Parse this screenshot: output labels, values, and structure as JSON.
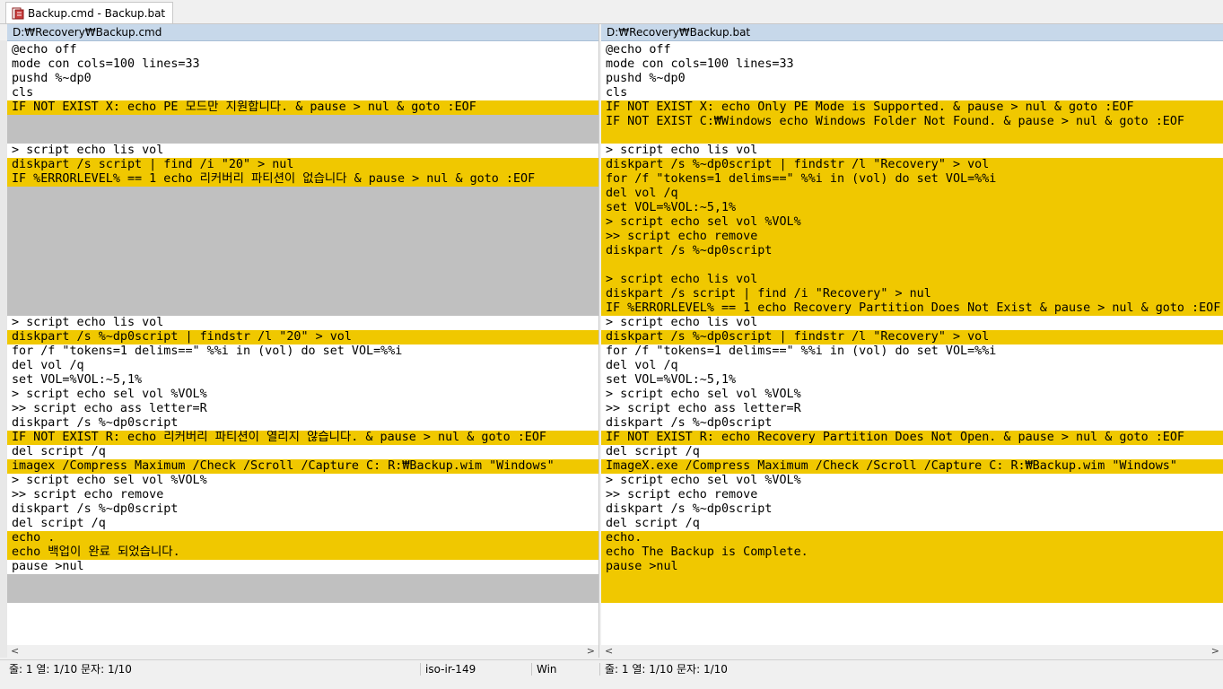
{
  "tab": {
    "title": "Backup.cmd - Backup.bat"
  },
  "left_pane": {
    "path": "D:₩Recovery₩Backup.cmd",
    "lines": [
      {
        "t": "@echo off",
        "c": ""
      },
      {
        "t": "mode con cols=100 lines=33",
        "c": ""
      },
      {
        "t": "pushd %~dp0",
        "c": ""
      },
      {
        "t": "cls",
        "c": ""
      },
      {
        "t": "IF NOT EXIST X: echo PE 모드만 지원합니다. & pause > nul & goto :EOF",
        "c": "changed"
      },
      {
        "t": "",
        "c": "gap"
      },
      {
        "t": "",
        "c": "gap"
      },
      {
        "t": "> script echo lis vol",
        "c": ""
      },
      {
        "t": "diskpart /s script | find /i \"20\" > nul",
        "c": "changed"
      },
      {
        "t": "IF %ERRORLEVEL% == 1 echo 리커버리 파티션이 없습니다 & pause > nul & goto :EOF",
        "c": "changed"
      },
      {
        "t": "",
        "c": "gap"
      },
      {
        "t": "",
        "c": "gap"
      },
      {
        "t": "",
        "c": "gap"
      },
      {
        "t": "",
        "c": "gap"
      },
      {
        "t": "",
        "c": "gap"
      },
      {
        "t": "",
        "c": "gap"
      },
      {
        "t": "",
        "c": "gap"
      },
      {
        "t": "",
        "c": "gap"
      },
      {
        "t": "",
        "c": "gap"
      },
      {
        "t": "> script echo lis vol",
        "c": ""
      },
      {
        "t": "diskpart /s %~dp0script | findstr /l \"20\" > vol",
        "c": "changed"
      },
      {
        "t": "for /f \"tokens=1 delims==\" %%i in (vol) do set VOL=%%i",
        "c": ""
      },
      {
        "t": "del vol /q",
        "c": ""
      },
      {
        "t": "set VOL=%VOL:~5,1%",
        "c": ""
      },
      {
        "t": "> script echo sel vol %VOL%",
        "c": ""
      },
      {
        "t": ">> script echo ass letter=R",
        "c": ""
      },
      {
        "t": "diskpart /s %~dp0script",
        "c": ""
      },
      {
        "t": "IF NOT EXIST R: echo 리커버리 파티션이 열리지 않습니다. & pause > nul & goto :EOF",
        "c": "changed"
      },
      {
        "t": "del script /q",
        "c": ""
      },
      {
        "t": "imagex /Compress Maximum /Check /Scroll /Capture C: R:₩Backup.wim \"Windows\"",
        "c": "changed"
      },
      {
        "t": "> script echo sel vol %VOL%",
        "c": ""
      },
      {
        "t": ">> script echo remove",
        "c": ""
      },
      {
        "t": "diskpart /s %~dp0script",
        "c": ""
      },
      {
        "t": "del script /q",
        "c": ""
      },
      {
        "t": "echo .",
        "c": "changed"
      },
      {
        "t": "echo 백업이 완료 되었습니다.",
        "c": "changed"
      },
      {
        "t": "pause >nul",
        "c": ""
      },
      {
        "t": "",
        "c": "gap"
      },
      {
        "t": "",
        "c": "gap"
      }
    ]
  },
  "right_pane": {
    "path": "D:₩Recovery₩Backup.bat",
    "lines": [
      {
        "t": "@echo off",
        "c": ""
      },
      {
        "t": "mode con cols=100 lines=33",
        "c": ""
      },
      {
        "t": "pushd %~dp0",
        "c": ""
      },
      {
        "t": "cls",
        "c": ""
      },
      {
        "t": "IF NOT EXIST X: echo Only PE Mode is Supported. & pause > nul & goto :EOF",
        "c": "changed"
      },
      {
        "t": "IF NOT EXIST C:₩Windows echo Windows Folder Not Found. & pause > nul & goto :EOF",
        "c": "changed"
      },
      {
        "t": "",
        "c": "fill"
      },
      {
        "t": "> script echo lis vol",
        "c": ""
      },
      {
        "t": "diskpart /s %~dp0script | findstr /l \"Recovery\" > vol",
        "c": "changed"
      },
      {
        "t": "for /f \"tokens=1 delims==\" %%i in (vol) do set VOL=%%i",
        "c": "changed"
      },
      {
        "t": "del vol /q",
        "c": "changed"
      },
      {
        "t": "set VOL=%VOL:~5,1%",
        "c": "changed"
      },
      {
        "t": "> script echo sel vol %VOL%",
        "c": "changed"
      },
      {
        "t": ">> script echo remove",
        "c": "changed"
      },
      {
        "t": "diskpart /s %~dp0script",
        "c": "changed"
      },
      {
        "t": "",
        "c": "fill"
      },
      {
        "t": "> script echo lis vol",
        "c": "changed"
      },
      {
        "t": "diskpart /s script | find /i \"Recovery\" > nul",
        "c": "changed"
      },
      {
        "t": "IF %ERRORLEVEL% == 1 echo Recovery Partition Does Not Exist & pause > nul & goto :EOF",
        "c": "changed"
      },
      {
        "t": "> script echo lis vol",
        "c": ""
      },
      {
        "t": "diskpart /s %~dp0script | findstr /l \"Recovery\" > vol",
        "c": "changed"
      },
      {
        "t": "for /f \"tokens=1 delims==\" %%i in (vol) do set VOL=%%i",
        "c": ""
      },
      {
        "t": "del vol /q",
        "c": ""
      },
      {
        "t": "set VOL=%VOL:~5,1%",
        "c": ""
      },
      {
        "t": "> script echo sel vol %VOL%",
        "c": ""
      },
      {
        "t": ">> script echo ass letter=R",
        "c": ""
      },
      {
        "t": "diskpart /s %~dp0script",
        "c": ""
      },
      {
        "t": "IF NOT EXIST R: echo Recovery Partition Does Not Open. & pause > nul & goto :EOF",
        "c": "changed"
      },
      {
        "t": "del script /q",
        "c": ""
      },
      {
        "t": "ImageX.exe /Compress Maximum /Check /Scroll /Capture C: R:₩Backup.wim \"Windows\"",
        "c": "changed"
      },
      {
        "t": "> script echo sel vol %VOL%",
        "c": ""
      },
      {
        "t": ">> script echo remove",
        "c": ""
      },
      {
        "t": "diskpart /s %~dp0script",
        "c": ""
      },
      {
        "t": "del script /q",
        "c": ""
      },
      {
        "t": "echo.",
        "c": "changed"
      },
      {
        "t": "echo The Backup is Complete.",
        "c": "changed"
      },
      {
        "t": "pause >nul",
        "c": "changed"
      },
      {
        "t": "",
        "c": "fill"
      },
      {
        "t": "",
        "c": "fill"
      }
    ]
  },
  "scroll": {
    "left_arrow": "<",
    "right_arrow": ">"
  },
  "status": {
    "left_pos": "줄: 1  열: 1/10  문자: 1/10",
    "encoding": "iso-ir-149",
    "eol": "Win",
    "right_pos": "줄: 1  열: 1/10  문자: 1/10"
  },
  "colors": {
    "changed": "#f0c800",
    "gap": "#c0c0c0",
    "keyword": "#0000c8",
    "number": "#c80000"
  }
}
